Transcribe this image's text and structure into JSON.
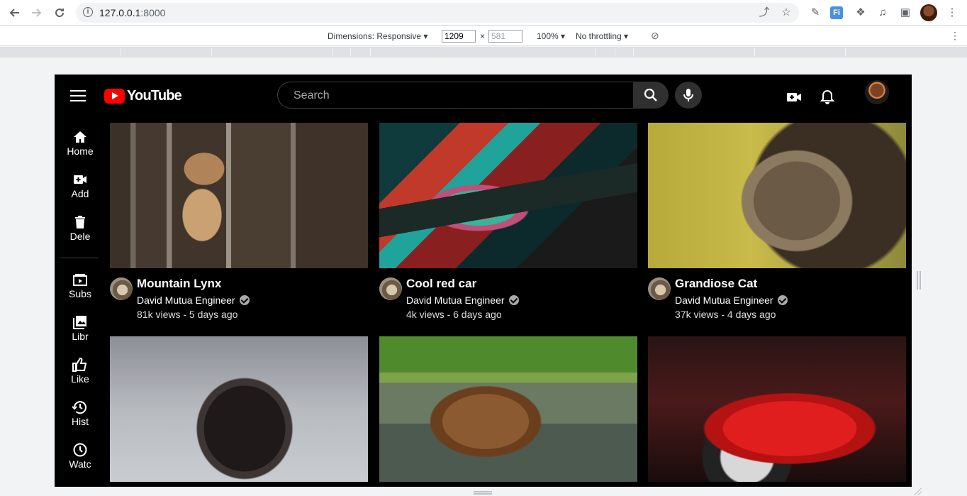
{
  "browser": {
    "url_host": "127.0.0.1",
    "url_port": ":8000"
  },
  "devtools": {
    "dimensions_label": "Dimensions: Responsive",
    "width": "1209",
    "height": "581",
    "zoom": "100%",
    "throttling": "No throttling",
    "times": "×"
  },
  "header": {
    "logo_text": "YouTube",
    "search_placeholder": "Search"
  },
  "sidebar": {
    "items": [
      {
        "label": "Home",
        "icon": "home-icon"
      },
      {
        "label": "Add",
        "icon": "add-video-icon"
      },
      {
        "label": "Dele",
        "icon": "trash-icon"
      },
      {
        "label": "Subs",
        "icon": "subscriptions-icon"
      },
      {
        "label": "Libr",
        "icon": "library-icon"
      },
      {
        "label": "Like",
        "icon": "thumbs-up-icon"
      },
      {
        "label": "Hist",
        "icon": "history-icon"
      },
      {
        "label": "Watc",
        "icon": "watch-later-icon"
      }
    ]
  },
  "videos": [
    {
      "title": "Mountain Lynx",
      "channel": "David Mutua Engineer",
      "meta": "81k views - 5 days ago"
    },
    {
      "title": "Cool red car",
      "channel": "David Mutua Engineer",
      "meta": "4k views - 6 days ago"
    },
    {
      "title": "Grandiose Cat",
      "channel": "David Mutua Engineer",
      "meta": "37k views - 4 days ago"
    },
    {
      "title": "",
      "channel": "",
      "meta": ""
    },
    {
      "title": "",
      "channel": "",
      "meta": ""
    },
    {
      "title": "",
      "channel": "",
      "meta": ""
    }
  ],
  "colors": {
    "brand_red": "#ff0000",
    "background": "#000000",
    "text": "#ffffff"
  }
}
